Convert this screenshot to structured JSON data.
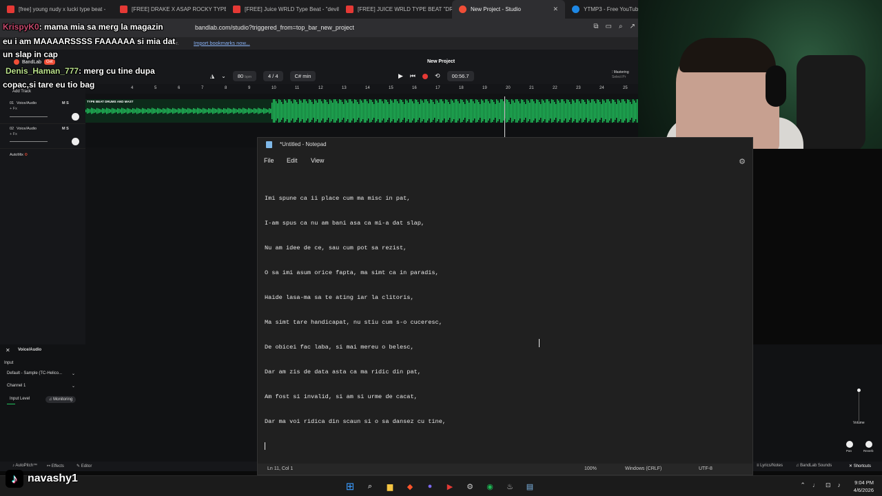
{
  "browser": {
    "tabs": [
      {
        "label": "[free] young nudy x lucki type beat -"
      },
      {
        "label": "[FREE] DRAKE X ASAP ROCKY TYPE B"
      },
      {
        "label": "[FREE] Juice WRLD Type Beat - \"devil"
      },
      {
        "label": "[FREE] JUICE WRLD TYPE BEAT \"DRUI"
      },
      {
        "label": "New Project - Studio",
        "active": true
      },
      {
        "label": "YTMP3 - Free YouTube"
      }
    ],
    "url": "bandlab.com/studio?triggered_from=top_bar_new_project",
    "bookmarks_hint": "bar.",
    "bookmarks_link": "Import bookmarks now..."
  },
  "chat": [
    {
      "user": "KrispyK0",
      "message": ": mama mia sa merg la magazin"
    },
    {
      "user": "",
      "message": "eu i am MAAAARSSSS FAAAAAA si mia dat"
    },
    {
      "user": "",
      "message": "un slap in cap"
    },
    {
      "user": "Denis_Haman_777",
      "message": ": merg cu tine dupa"
    },
    {
      "user": "",
      "message": "copac,si tare eu tio bag"
    }
  ],
  "bandlab": {
    "logo_text": "BandLab",
    "get_badge": "Get",
    "project_title": "New Project",
    "bpm": "80",
    "bpm_unit": "bpm",
    "time_signature": "4 / 4",
    "key": "C# min",
    "time": "00:56.7",
    "mastering_label": "Mastering",
    "mastering_sub": "Select Pr",
    "add_track": "Add Track",
    "automix": "AutoMix",
    "ruler": [
      "4",
      "5",
      "6",
      "7",
      "8",
      "9",
      "10",
      "11",
      "12",
      "13",
      "14",
      "15",
      "16",
      "17",
      "18",
      "19",
      "20",
      "21",
      "22",
      "23",
      "24",
      "25"
    ],
    "tracks": [
      {
        "number": "01",
        "name": "Voice/Audio",
        "fx": "+ Fx",
        "clip": "TYPE BEAT DRUMS AND MAST"
      },
      {
        "number": "02",
        "name": "Voice/Audio",
        "fx": "+ Fx"
      }
    ],
    "panel": {
      "title": "Voice/Audio",
      "input_label": "Input",
      "input_device": "Default - Sample (TC-Helico...",
      "channel": "Channel 1",
      "input_level": "Input Level",
      "monitoring": "Monitoring",
      "volume": "Volume",
      "pan": "Pan",
      "reverb": "Reverb"
    },
    "bottom_bar": {
      "autopitch": "AutoPitch™",
      "effects": "Effects",
      "editor": "Editor",
      "lyrics": "Lyrics/Notes",
      "sounds": "BandLab Sounds",
      "shortcuts": "Shortcuts"
    }
  },
  "notepad": {
    "title": "*Untitled - Notepad",
    "menu": [
      "File",
      "Edit",
      "View"
    ],
    "lines": [
      "Imi spune ca ii place cum ma misc in pat,",
      "I-am spus ca nu am bani asa ca mi-a dat slap,",
      "Nu am idee de ce, sau cum pot sa rezist,",
      "O sa imi asum orice fapta, ma simt ca in paradis,",
      "Haide lasa-ma sa te ating iar la clitoris,",
      "Ma simt tare handicapat, nu stiu cum s-o cuceresc,",
      "De obicei fac laba, si mai mereu o belesc,",
      "Dar am zis de data asta ca ma ridic din pat,",
      "Am fost si invalid, si am si urme de cacat,",
      "Dar ma voi ridica din scaun si o sa dansez cu tine,"
    ],
    "status": {
      "position": "Ln 11, Col 1",
      "zoom": "100%",
      "line_ending": "Windows (CRLF)",
      "encoding": "UTF-8"
    }
  },
  "tiktok": {
    "handle": "navashy1"
  },
  "taskbar": {
    "time": "9:04 PM",
    "date": "4/6/2026"
  },
  "colors": {
    "waveform": "#22c55e",
    "record": "#e53935",
    "bandlab_red": "#f04e37"
  }
}
